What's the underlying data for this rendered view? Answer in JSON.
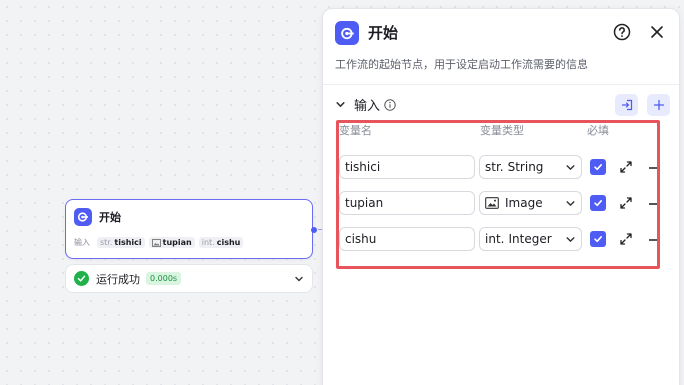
{
  "node": {
    "title": "开始",
    "inputs_label": "输入",
    "inputs": [
      {
        "type_prefix": "str.",
        "name": "tishici"
      },
      {
        "type_prefix": "img",
        "name": "tupian"
      },
      {
        "type_prefix": "int.",
        "name": "cishu"
      }
    ]
  },
  "run_status": {
    "text": "运行成功",
    "time": "0.000s"
  },
  "panel": {
    "title": "开始",
    "description": "工作流的起始节点，用于设定启动工作流需要的信息",
    "section_title": "输入",
    "columns": {
      "name": "变量名",
      "type": "变量类型",
      "required": "必填"
    },
    "rows": [
      {
        "name": "tishici",
        "type_prefix": "str.",
        "type_label": "String",
        "required": true
      },
      {
        "name": "tupian",
        "type_prefix": "",
        "type_label": "Image",
        "required": true
      },
      {
        "name": "cishu",
        "type_prefix": "int.",
        "type_label": "Integer",
        "required": true
      }
    ]
  },
  "colors": {
    "accent": "#4e5cf4",
    "success": "#21b14b",
    "highlight": "#e8545b"
  }
}
